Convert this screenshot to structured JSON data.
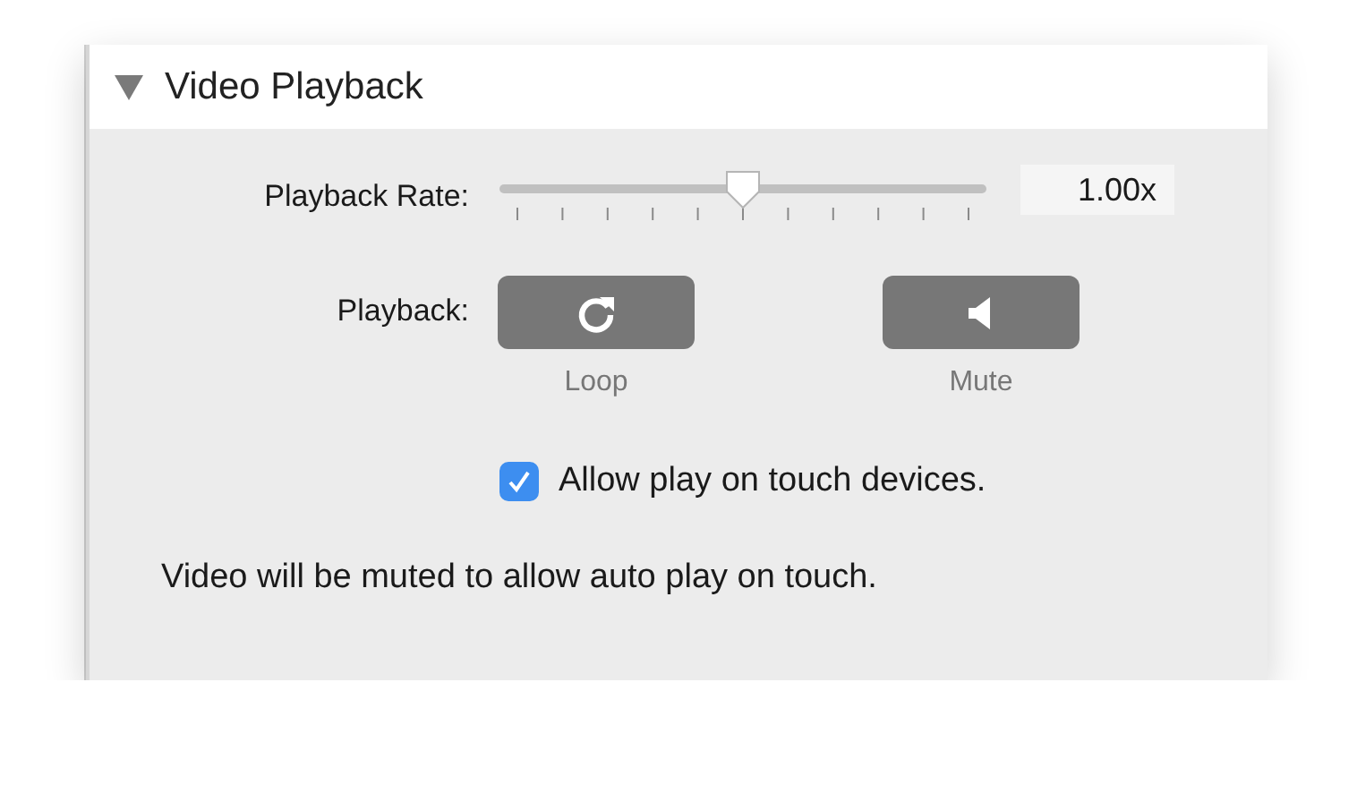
{
  "section": {
    "title": "Video Playback",
    "expanded": true
  },
  "playback_rate": {
    "label": "Playback Rate:",
    "level": 0.5,
    "value": "1.00x"
  },
  "playback": {
    "label": "Playback:",
    "buttons": [
      {
        "kind": "loop",
        "caption": "Loop"
      },
      {
        "kind": "mute",
        "caption": "Mute"
      }
    ]
  },
  "touch_option": {
    "label": "Allow play on touch devices.",
    "checked": true
  },
  "note": "Video will be muted to allow auto play on touch."
}
